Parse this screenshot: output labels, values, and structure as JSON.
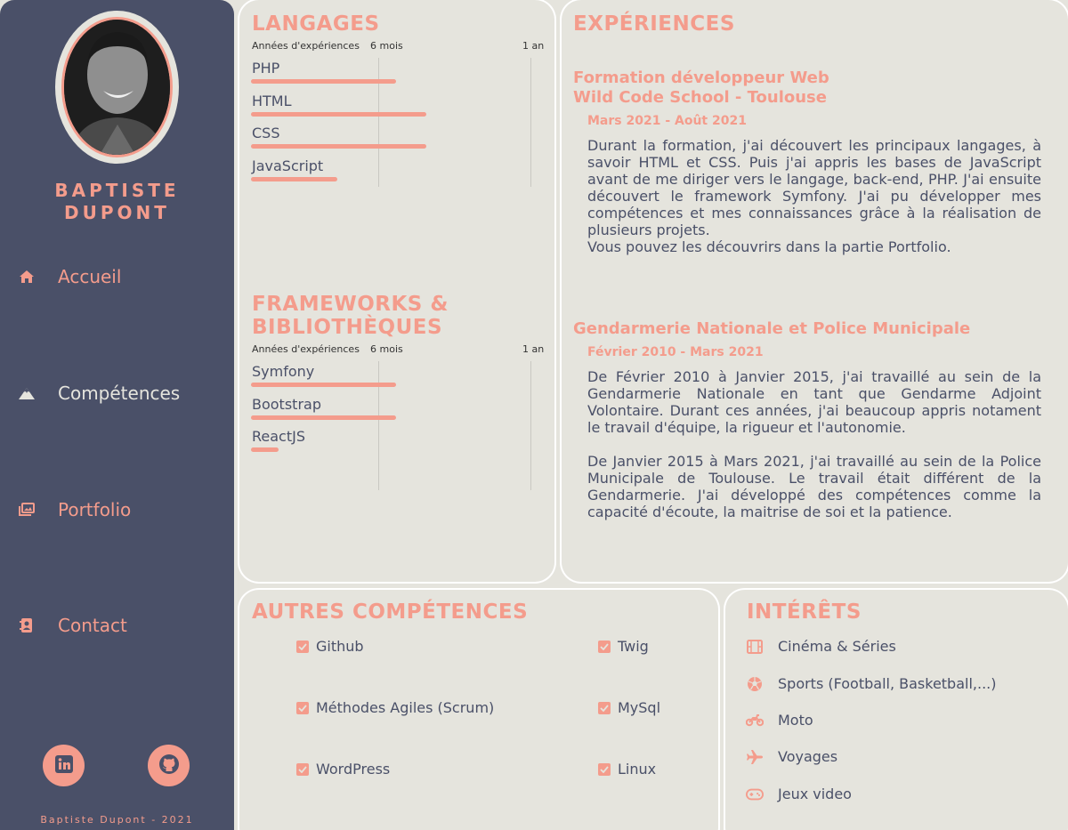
{
  "profile": {
    "first_name": "BAPTISTE",
    "last_name": "DUPONT",
    "footer": "Baptiste Dupont - 2021"
  },
  "nav": [
    {
      "label": "Accueil",
      "icon": "home-icon"
    },
    {
      "label": "Compétences",
      "icon": "mountain-icon"
    },
    {
      "label": "Portfolio",
      "icon": "images-icon"
    },
    {
      "label": "Contact",
      "icon": "address-book-icon"
    }
  ],
  "social": [
    "linkedin-icon",
    "github-icon"
  ],
  "langages": {
    "title": "LANGAGES",
    "header": {
      "label": "Années d'expériences",
      "mid": "6 mois",
      "end": "1 an"
    },
    "items": [
      {
        "label": "PHP",
        "fraction": 0.52
      },
      {
        "label": "HTML",
        "fraction": 0.63
      },
      {
        "label": "CSS",
        "fraction": 0.63
      },
      {
        "label": "JavaScript",
        "fraction": 0.31
      }
    ]
  },
  "frameworks": {
    "title_line1": "FRAMEWORKS &",
    "title_line2": "BIBLIOTHÈQUES",
    "header": {
      "label": "Années d'expériences",
      "mid": "6 mois",
      "end": "1 an"
    },
    "items": [
      {
        "label": "Symfony",
        "fraction": 0.52
      },
      {
        "label": "Bootstrap",
        "fraction": 0.52
      },
      {
        "label": "ReactJS",
        "fraction": 0.1
      }
    ]
  },
  "experiences": {
    "title": "EXPÉRIENCES",
    "items": [
      {
        "title_line1": "Formation développeur Web",
        "title_line2": "Wild Code School - Toulouse",
        "date": "Mars 2021 - Août 2021",
        "text": "Durant la formation, j'ai découvert les principaux langages, à savoir HTML et CSS. Puis j'ai appris les bases de JavaScript avant de me diriger vers le langage, back-end, PHP. J'ai ensuite découvert le framework Symfony. J'ai pu développer mes compétences et mes connaissances grâce à la réalisation de plusieurs projets.",
        "text2": "Vous pouvez les découvrirs dans la partie Portfolio."
      },
      {
        "title_line1": "Gendarmerie Nationale et Police Municipale",
        "date": "Février 2010 - Mars 2021",
        "text": "De Février 2010 à Janvier 2015, j'ai travaillé au sein de la Gendarmerie Nationale en tant que Gendarme Adjoint Volontaire. Durant ces années, j'ai beaucoup appris notament le travail d'équipe, la rigueur et l'autonomie.",
        "text2": "De Janvier 2015 à Mars 2021, j'ai travaillé au sein de la Police Municipale de Toulouse. Le travail était différent de la Gendarmerie. J'ai développé des compétences comme la capacité d'écoute, la maitrise de soi et la patience."
      }
    ]
  },
  "autres": {
    "title": "AUTRES COMPÉTENCES",
    "items": [
      "Github",
      "Twig",
      "Méthodes Agiles (Scrum)",
      "MySql",
      "WordPress",
      "Linux"
    ]
  },
  "interets": {
    "title": "INTÉRÊTS",
    "items": [
      {
        "label": "Cinéma & Séries",
        "icon": "film-icon"
      },
      {
        "label": "Sports (Football, Basketball,...)",
        "icon": "soccer-ball-icon"
      },
      {
        "label": "Moto",
        "icon": "motorcycle-icon"
      },
      {
        "label": "Voyages",
        "icon": "plane-icon"
      },
      {
        "label": "Jeux video",
        "icon": "gamepad-icon"
      }
    ]
  },
  "colors": {
    "accent": "#f49c8c",
    "sidebar": "#4a5068",
    "card": "#e5e4dd",
    "text": "#4a5068"
  }
}
